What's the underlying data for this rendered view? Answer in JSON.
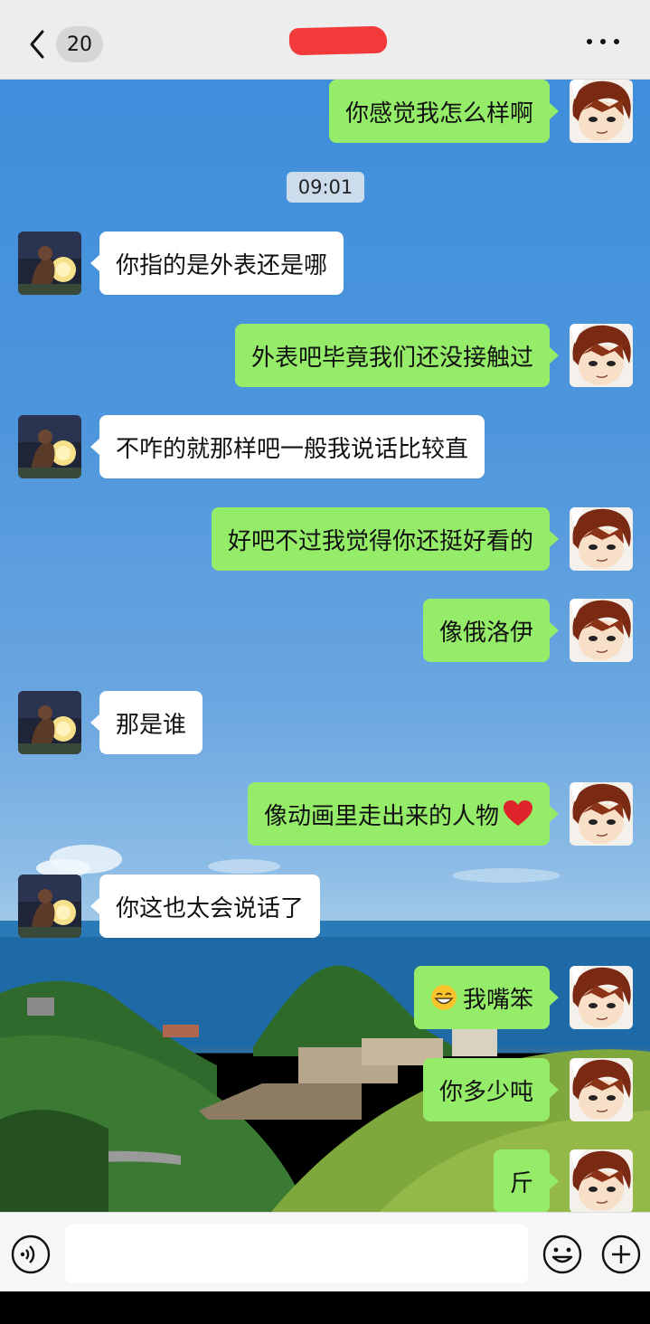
{
  "header": {
    "unread_count": "20",
    "back_icon": "chevron-left-icon",
    "more_icon": "more-horizontal-icon"
  },
  "timestamp": "09:01",
  "messages": [
    {
      "side": "me",
      "text": "你感觉我怎么样啊"
    },
    {
      "side": "them",
      "text": "你指的是外表还是哪"
    },
    {
      "side": "me",
      "text": "外表吧毕竟我们还没接触过"
    },
    {
      "side": "them",
      "text": "不咋的就那样吧一般我说话比较直"
    },
    {
      "side": "me",
      "text": "好吧不过我觉得你还挺好看的"
    },
    {
      "side": "me",
      "text": "像俄洛伊"
    },
    {
      "side": "them",
      "text": "那是谁"
    },
    {
      "side": "me",
      "text": "像动画里走出来的人物"
    },
    {
      "side": "them",
      "text": "你这也太会说话了"
    },
    {
      "side": "me",
      "text": "我嘴笨"
    },
    {
      "side": "me",
      "text": "你多少吨"
    },
    {
      "side": "me",
      "text": "斤"
    }
  ],
  "inputbar": {
    "value": "",
    "voice_icon": "voice-icon",
    "emoji_icon": "emoji-icon",
    "plus_icon": "plus-icon"
  },
  "colors": {
    "my_bubble": "#95ec69",
    "their_bubble": "#ffffff",
    "title_redaction": "#f23a3a"
  }
}
